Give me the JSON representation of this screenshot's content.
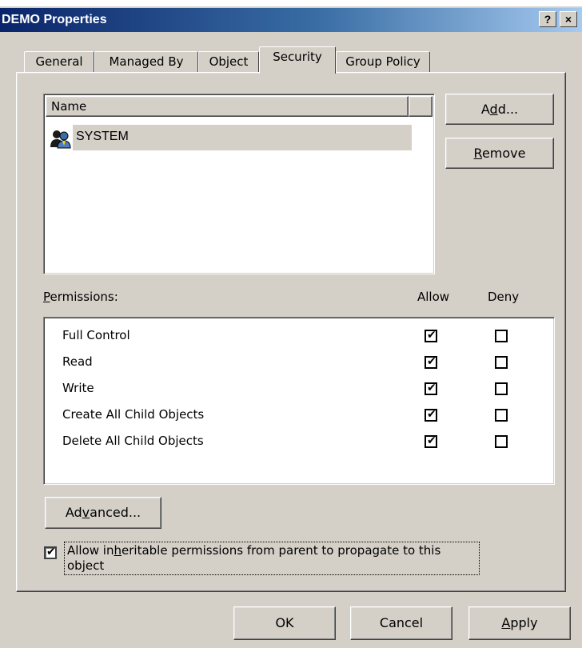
{
  "window": {
    "title": "DEMO Properties",
    "help_label": "?",
    "close_label": "×"
  },
  "tabs": [
    {
      "label": "General",
      "active": false
    },
    {
      "label": "Managed By",
      "active": false
    },
    {
      "label": "Object",
      "active": false
    },
    {
      "label": "Security",
      "active": true
    },
    {
      "label": "Group Policy",
      "active": false
    }
  ],
  "names_list": {
    "header": "Name",
    "items": [
      {
        "label": "SYSTEM",
        "icon": "user-group-icon",
        "selected": true
      }
    ]
  },
  "buttons": {
    "add": {
      "pre": "A",
      "key": "d",
      "post": "d..."
    },
    "remove": {
      "pre": "",
      "key": "R",
      "post": "emove"
    },
    "advanced": {
      "pre": "Ad",
      "key": "v",
      "post": "anced..."
    },
    "ok": "OK",
    "cancel": "Cancel",
    "apply": {
      "pre": "",
      "key": "A",
      "post": "pply"
    }
  },
  "permissions": {
    "label": {
      "pre": "",
      "key": "P",
      "post": "ermissions:"
    },
    "allow_header": "Allow",
    "deny_header": "Deny",
    "rows": [
      {
        "name": "Full Control",
        "allow": true,
        "deny": false
      },
      {
        "name": "Read",
        "allow": true,
        "deny": false
      },
      {
        "name": "Write",
        "allow": true,
        "deny": false
      },
      {
        "name": "Create All Child Objects",
        "allow": true,
        "deny": false
      },
      {
        "name": "Delete All Child Objects",
        "allow": true,
        "deny": false
      }
    ]
  },
  "inherit": {
    "checked": true,
    "line1_pre": "Allow in",
    "line1_key": "h",
    "line1_post": "eritable permissions from parent to propagate to this",
    "line2": "object"
  },
  "colors": {
    "face": "#d4d0c8",
    "title_start": "#0a246a",
    "title_end": "#a6caf0",
    "selection": "#d4d0c8"
  }
}
